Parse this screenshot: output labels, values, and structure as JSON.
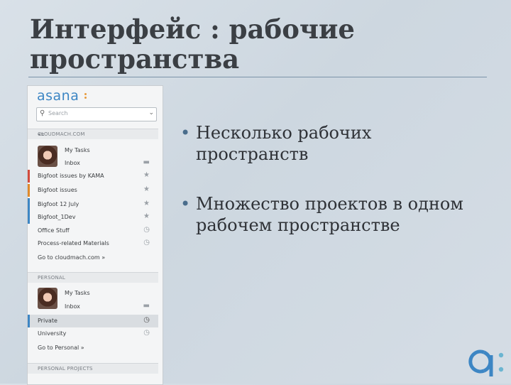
{
  "slide": {
    "title": "Интерфейс : рабочие пространства",
    "bullets": [
      "Несколько рабочих пространств",
      "Множество проектов в одном рабочем пространстве"
    ],
    "corner_logo_icon": "asana-logo-icon"
  },
  "sidebar": {
    "logo": "asana",
    "search_placeholder": "Search",
    "workspaces": [
      {
        "name": "CLOUDMACH.COM",
        "my_tasks": "My Tasks",
        "inbox": "Inbox",
        "projects": [
          {
            "label": "Bigfoot issues by KAMA",
            "color": "#d24b3c",
            "icon": "star-icon"
          },
          {
            "label": "Bigfoot issues",
            "color": "#e08a2a",
            "icon": "star-icon"
          },
          {
            "label": "Bigfoot 12 July",
            "color": "#3d86c4",
            "icon": "star-icon"
          },
          {
            "label": "Bigfoot_1Dev",
            "color": "#3d86c4",
            "icon": "star-icon"
          },
          {
            "label": "Office Stuff",
            "color": "",
            "icon": "clock-icon"
          },
          {
            "label": "Process-related Materials",
            "color": "",
            "icon": "clock-icon"
          }
        ],
        "go_to": "Go to cloudmach.com »"
      },
      {
        "name": "PERSONAL",
        "my_tasks": "My Tasks",
        "inbox": "Inbox",
        "projects": [
          {
            "label": "Private",
            "color": "#3d86c4",
            "icon": "clock-icon"
          },
          {
            "label": "University",
            "color": "",
            "icon": "clock-icon"
          }
        ],
        "go_to": "Go to Personal »"
      },
      {
        "name": "PERSONAL PROJECTS"
      }
    ]
  }
}
